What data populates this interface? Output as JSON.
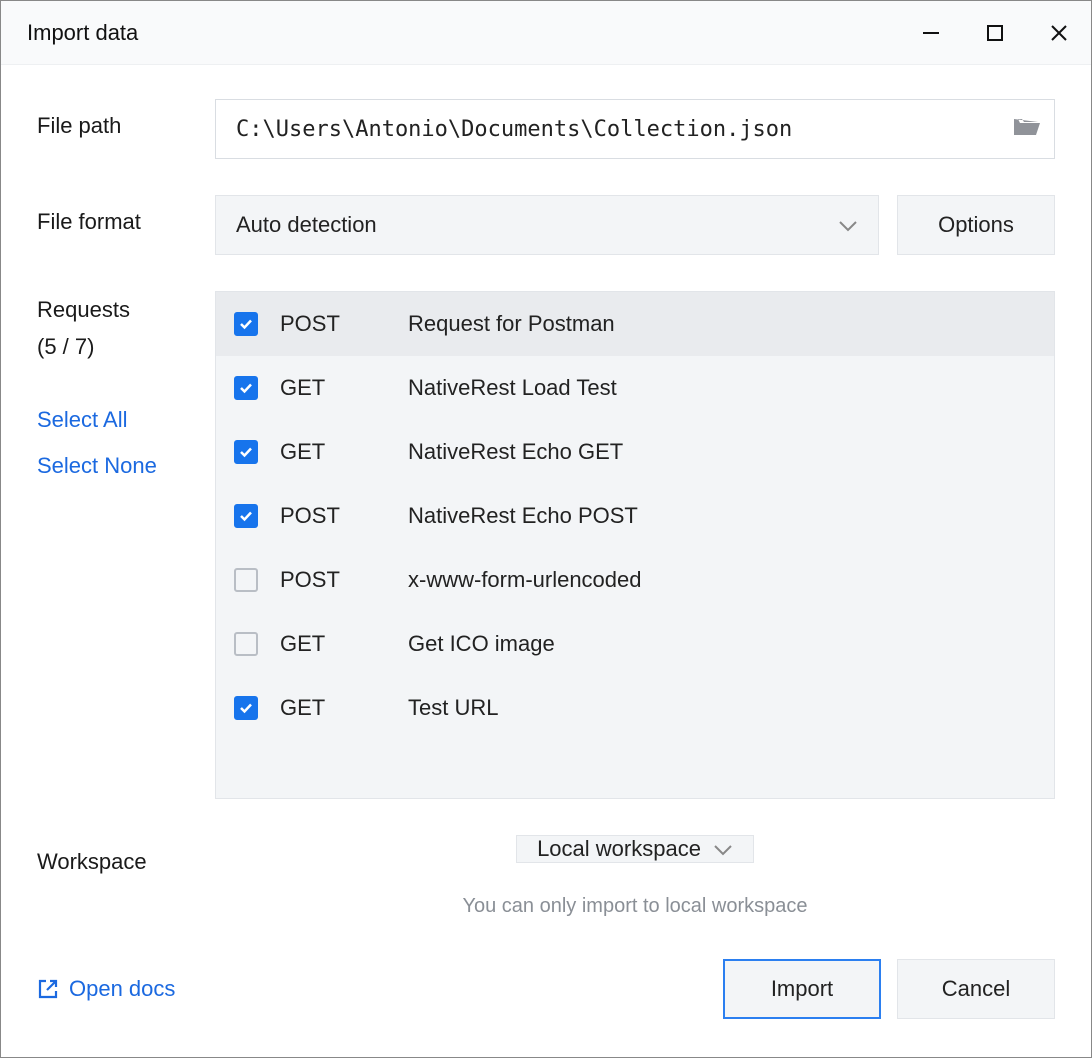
{
  "titlebar": {
    "title": "Import data"
  },
  "labels": {
    "file_path": "File path",
    "file_format": "File format",
    "requests": "Requests",
    "workspace": "Workspace"
  },
  "file_path": {
    "value": "C:\\Users\\Antonio\\Documents\\Collection.json"
  },
  "file_format": {
    "value": "Auto detection",
    "options_btn": "Options"
  },
  "requests": {
    "counter": "(5 / 7)",
    "select_all": "Select All",
    "select_none": "Select None",
    "items": [
      {
        "checked": true,
        "method": "POST",
        "name": "Request for Postman",
        "selected": true
      },
      {
        "checked": true,
        "method": "GET",
        "name": "NativeRest Load Test",
        "selected": false
      },
      {
        "checked": true,
        "method": "GET",
        "name": "NativeRest Echo GET",
        "selected": false
      },
      {
        "checked": true,
        "method": "POST",
        "name": "NativeRest Echo POST",
        "selected": false
      },
      {
        "checked": false,
        "method": "POST",
        "name": "x-www-form-urlencoded",
        "selected": false
      },
      {
        "checked": false,
        "method": "GET",
        "name": "Get ICO image",
        "selected": false
      },
      {
        "checked": true,
        "method": "GET",
        "name": "Test URL",
        "selected": false
      }
    ]
  },
  "workspace": {
    "value": "Local workspace",
    "hint": "You can only import to local workspace"
  },
  "footer": {
    "open_docs": "Open docs",
    "import": "Import",
    "cancel": "Cancel"
  }
}
